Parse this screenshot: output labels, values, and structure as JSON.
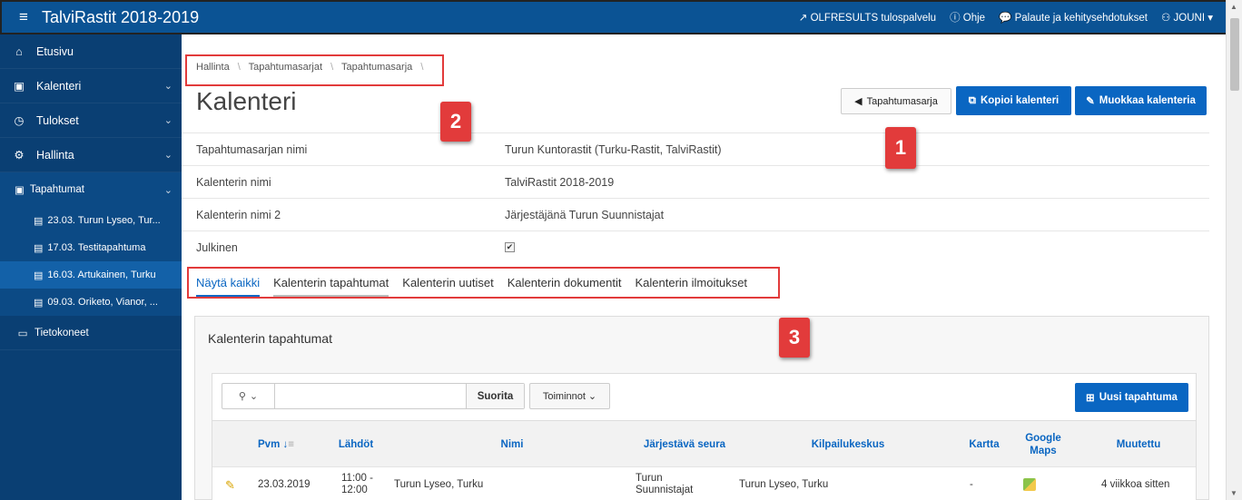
{
  "header": {
    "title": "TalviRastit 2018-2019",
    "nav": {
      "results": "OLFRESULTS tulospalvelu",
      "help": "Ohje",
      "feedback": "Palaute ja kehitysehdotukset",
      "user": "JOUNI"
    }
  },
  "sidebar": {
    "items": [
      {
        "label": "Etusivu"
      },
      {
        "label": "Kalenteri"
      },
      {
        "label": "Tulokset"
      },
      {
        "label": "Hallinta"
      },
      {
        "label": "Tapahtumat"
      },
      {
        "label": "23.03. Turun Lyseo, Tur..."
      },
      {
        "label": "17.03. Testitapahtuma"
      },
      {
        "label": "16.03. Artukainen, Turku"
      },
      {
        "label": "09.03. Oriketo, Vianor, ..."
      },
      {
        "label": "Tietokoneet"
      }
    ]
  },
  "breadcrumb": {
    "items": [
      "Hallinta",
      "Tapahtumasarjat",
      "Tapahtumasarja"
    ],
    "sep": "\\"
  },
  "page": {
    "title": "Kalenteri",
    "btn_back": "Tapahtumasarja",
    "btn_copy": "Kopioi kalenteri",
    "btn_edit": "Muokkaa kalenteria"
  },
  "details": [
    {
      "label": "Tapahtumasarjan nimi",
      "value": "Turun Kuntorastit (Turku-Rastit, TalviRastit)"
    },
    {
      "label": "Kalenterin nimi",
      "value": "TalviRastit 2018-2019"
    },
    {
      "label": "Kalenterin nimi 2",
      "value": "Järjestäjänä Turun Suunnistajat"
    },
    {
      "label": "Julkinen",
      "value": "✔"
    }
  ],
  "tabs": [
    "Näytä kaikki",
    "Kalenterin tapahtumat",
    "Kalenterin uutiset",
    "Kalenterin dokumentit",
    "Kalenterin ilmoitukset"
  ],
  "panel": {
    "title": "Kalenterin tapahtumat",
    "search_value": "",
    "search_btn": "Suorita",
    "actions": "Toiminnot",
    "new_btn": "Uusi tapahtuma"
  },
  "table": {
    "headers": {
      "pvm": "Pvm ↓",
      "lahdot": "Lähdöt",
      "nimi": "Nimi",
      "seura": "Järjestävä seura",
      "keskus": "Kilpailukeskus",
      "kartta": "Kartta",
      "gmaps1": "Google",
      "gmaps2": "Maps",
      "muutettu": "Muutettu"
    },
    "row": {
      "pvm": "23.03.2019",
      "lahdot1": "11:00 -",
      "lahdot2": "12:00",
      "nimi": "Turun Lyseo, Turku",
      "seura1": "Turun",
      "seura2": "Suunnistajat",
      "keskus": "Turun Lyseo, Turku",
      "kartta": "-",
      "muutettu": "4 viikkoa sitten"
    }
  },
  "callouts": [
    "1",
    "2",
    "3"
  ],
  "colors": {
    "accent": "#0a66c2",
    "header": "#0b5394",
    "sidebar": "#0a3f73",
    "callout": "#e23b3b"
  }
}
